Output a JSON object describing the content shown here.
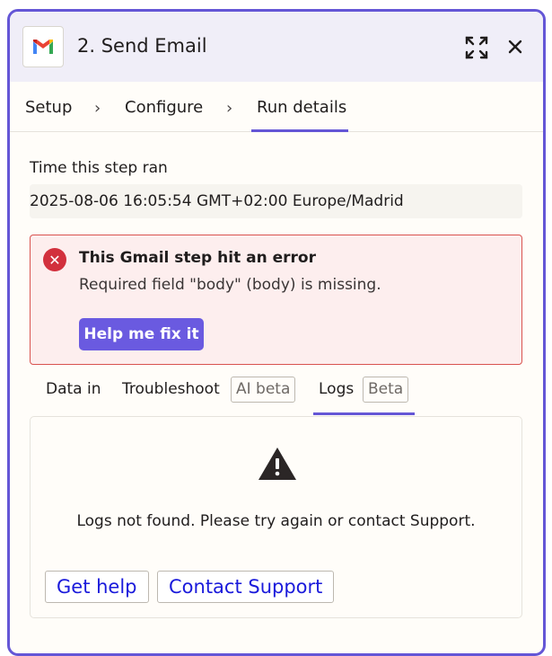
{
  "header": {
    "app_icon": "gmail-icon",
    "title": "2. Send Email",
    "expand_icon": "expand-icon",
    "close_icon": "close-icon"
  },
  "steps": {
    "items": [
      "Setup",
      "Configure",
      "Run details"
    ],
    "active": "Run details"
  },
  "run_time": {
    "label": "Time this step ran",
    "value": "2025-08-06 16:05:54 GMT+02:00 Europe/Madrid"
  },
  "error": {
    "title": "This Gmail step hit an error",
    "message": "Required field \"body\" (body) is missing.",
    "button_label": "Help me fix it"
  },
  "tabs": {
    "items": [
      {
        "label": "Data in",
        "badge": ""
      },
      {
        "label": "Troubleshoot",
        "badge": "AI beta"
      },
      {
        "label": "Logs",
        "badge": "Beta"
      }
    ],
    "active": "Logs"
  },
  "logs": {
    "message": "Logs not found. Please try again or contact Support.",
    "get_help_label": "Get help",
    "contact_support_label": "Contact Support"
  },
  "colors": {
    "accent": "#6456d6",
    "button": "#6a5ae0",
    "error_bg": "#fdeeee",
    "error_border": "#d9534f",
    "error_icon": "#d2303d",
    "link": "#1a1adb"
  }
}
